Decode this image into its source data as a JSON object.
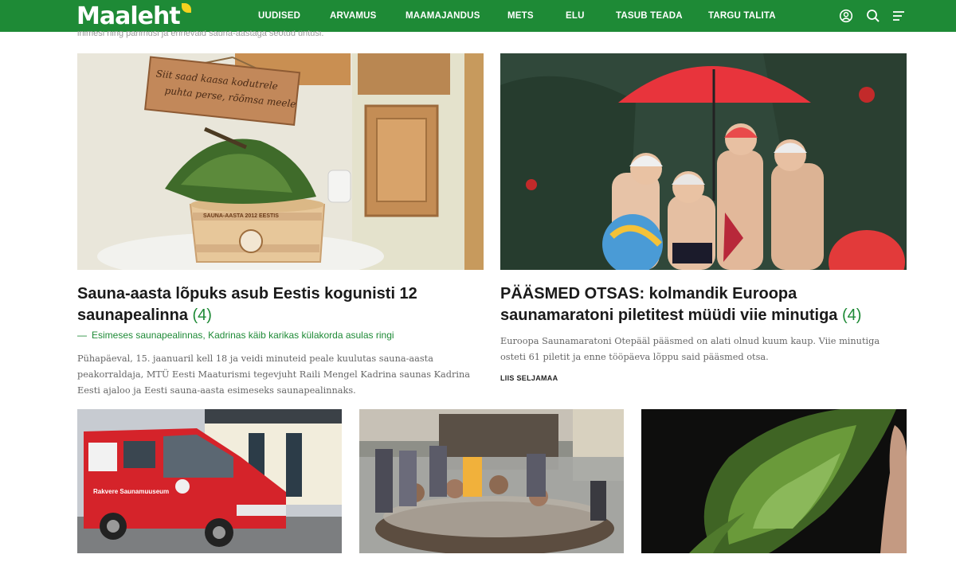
{
  "header": {
    "logo_text": "Maaleht",
    "nav": [
      "UUDISED",
      "ARVAMUS",
      "MAAMAJANDUS",
      "METS",
      "ELU",
      "TASUB TEADA",
      "TARGU TALITA"
    ],
    "icons": [
      "user-icon",
      "search-icon",
      "menu-icon"
    ],
    "brand_color": "#1e8a36"
  },
  "top_cut_text": "inimesi ning parimusi ja erinevaid sauna-aastaga seotud üritusi.",
  "articles": [
    {
      "title": "Sauna-aasta lõpuks asub Eestis kogunisti 12 saunapealinna",
      "comments": "(4)",
      "related": "Esimeses saunapealinnas, Kadrinas käib karikas külakorda asulas ringi",
      "lead": "Pühapäeval, 15. jaanuaril kell 18 ja veidi minuteid peale kuulutas sauna-aasta peakorraldaja, MTÜ Eesti Maaturismi tegevjuht Raili Mengel Kadrina saunas Kadrina Eesti ajaloo ja Eesti sauna-aasta esimeseks saunapealinnaks.",
      "image": {
        "sign_text_1": "Siit saad kaasa kodutrele",
        "sign_text_2": "puhta perse, rõõmsa meele",
        "tub_label": "SAUNA-AASTA 2012 EESTIS"
      }
    },
    {
      "title": "PÄÄSMED OTSAS: kolmandik Euroopa saunamaratoni piletitest müüdi viie minutiga",
      "comments": "(4)",
      "lead": "Euroopa Saunamaratoni Otepääl pääsmed on alati olnud kuum kaup. Viie minutiga osteti 61 piletit ja enne tööpäeva lõppu said pääsmed otsa.",
      "author": "LIIS SELJAMAA"
    }
  ],
  "small_images": [
    {
      "alt": "Punane saunabuss",
      "van_text": "Rakvere Saunamuuseum"
    },
    {
      "alt": "Inimesed kümblustünnis"
    },
    {
      "alt": "Saunaviht"
    }
  ]
}
